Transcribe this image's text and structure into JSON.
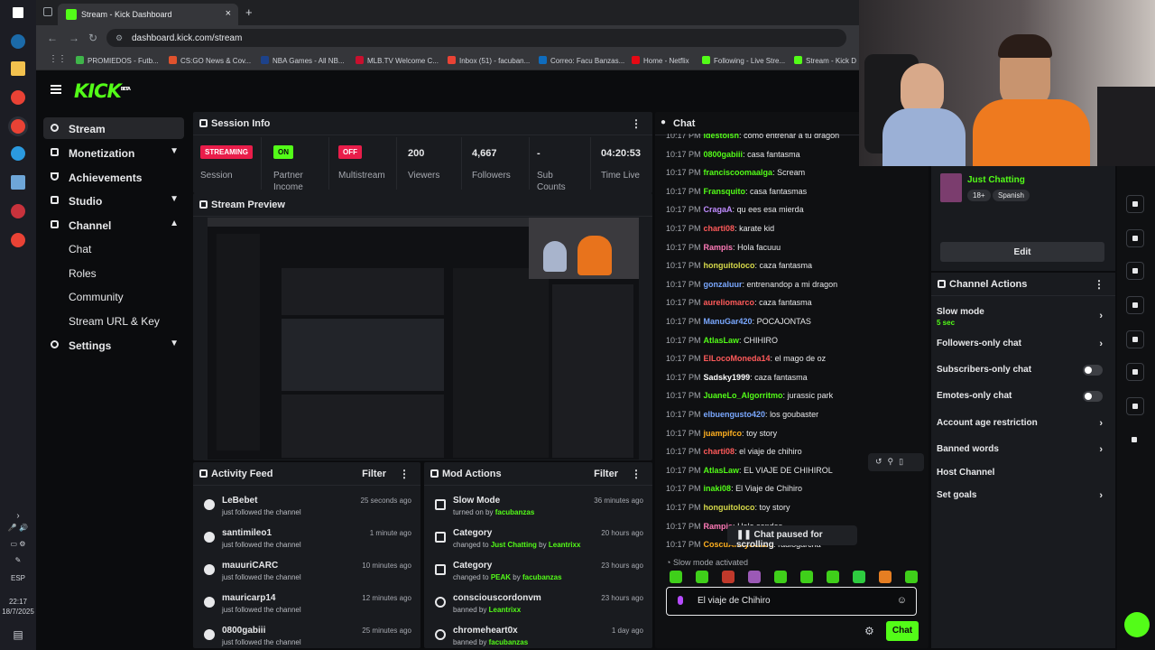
{
  "taskbar": {
    "lang": "ESP",
    "time": "22:17",
    "date": "18/7/2025"
  },
  "browser": {
    "tab_title": "Stream - Kick Dashboard",
    "url": "dashboard.kick.com/stream",
    "bookmarks": [
      "PROMIEDOS - Futb...",
      "CS:GO News & Cov...",
      "NBA Games - All NB...",
      "MLB.TV Welcome C...",
      "Inbox (51) - facuban...",
      "Correo: Facu Banzas...",
      "Home - Netflix",
      "Following - Live Stre...",
      "Stream - Kick D"
    ]
  },
  "logo": {
    "text": "KICK",
    "sup": "BETA"
  },
  "sidebar": {
    "items": [
      {
        "label": "Stream"
      },
      {
        "label": "Monetization"
      },
      {
        "label": "Achievements"
      },
      {
        "label": "Studio"
      },
      {
        "label": "Channel"
      }
    ],
    "channel_sub": [
      "Chat",
      "Roles",
      "Community",
      "Stream URL & Key"
    ],
    "settings": "Settings"
  },
  "session": {
    "title": "Session Info",
    "streaming_badge": "STREAMING",
    "session_label": "Session",
    "partner_badge": "ON",
    "partner_label": "Partner Income",
    "multistream_badge": "OFF",
    "multistream_label": "Multistream",
    "viewers": "200",
    "viewers_label": "Viewers",
    "followers": "4,667",
    "followers_label": "Followers",
    "subs": "-",
    "subs_label": "Sub Counts",
    "time": "04:20:53",
    "time_label": "Time Live"
  },
  "preview": {
    "title": "Stream Preview"
  },
  "activity": {
    "title": "Activity Feed",
    "filter": "Filter",
    "rows": [
      {
        "name": "LeBebet",
        "desc": "just followed the channel",
        "time": "25 seconds ago"
      },
      {
        "name": "santimileo1",
        "desc": "just followed the channel",
        "time": "1 minute ago"
      },
      {
        "name": "mauuriCARC",
        "desc": "just followed the channel",
        "time": "10 minutes ago"
      },
      {
        "name": "mauricarp14",
        "desc": "just followed the channel",
        "time": "12 minutes ago"
      },
      {
        "name": "0800gabiii",
        "desc": "just followed the channel",
        "time": "25 minutes ago"
      }
    ]
  },
  "mod": {
    "title": "Mod Actions",
    "filter": "Filter",
    "rows": [
      {
        "name": "Slow Mode",
        "pre": "turned on by",
        "hl": "facubanzas",
        "mid": "",
        "hl2": "",
        "time": "36 minutes ago"
      },
      {
        "name": "Category",
        "pre": "changed to",
        "hl": "Just Chatting",
        "mid": "by",
        "hl2": "Leantrixx",
        "time": "20 hours ago"
      },
      {
        "name": "Category",
        "pre": "changed to",
        "hl": "PEAK",
        "mid": "by",
        "hl2": "facubanzas",
        "time": "23 hours ago"
      },
      {
        "name": "consciouscordonvm",
        "pre": "banned by",
        "hl": "Leantrixx",
        "mid": "",
        "hl2": "",
        "time": "23 hours ago"
      },
      {
        "name": "chromeheart0x",
        "pre": "banned by",
        "hl": "facubanzas",
        "mid": "",
        "hl2": "",
        "time": "1 day ago"
      }
    ]
  },
  "chat": {
    "title": "Chat",
    "messages": [
      {
        "time": "10:17 PM",
        "user": "idestoish",
        "color": "#53fc18",
        "text": "como entrenar a tu dragon"
      },
      {
        "time": "10:17 PM",
        "user": "0800gabiii",
        "color": "#53fc18",
        "text": "casa fantasma"
      },
      {
        "time": "10:17 PM",
        "user": "franciscoomaalga",
        "color": "#53fc18",
        "text": "Scream"
      },
      {
        "time": "10:17 PM",
        "user": "Fransquito",
        "color": "#53fc18",
        "text": "casa fantasmas"
      },
      {
        "time": "10:17 PM",
        "user": "CragaA",
        "color": "#c08cff",
        "text": "qu ees esa mierda"
      },
      {
        "time": "10:17 PM",
        "user": "charti08",
        "color": "#ff5a5a",
        "text": "karate kid"
      },
      {
        "time": "10:17 PM",
        "user": "Rampis",
        "color": "#ff7ab8",
        "text": "Hola facuuu"
      },
      {
        "time": "10:17 PM",
        "user": "honguitoloco",
        "color": "#d6d94a",
        "text": "caza fantasma"
      },
      {
        "time": "10:17 PM",
        "user": "gonzaluur",
        "color": "#7aa8ff",
        "text": "entrenandop a mi dragon"
      },
      {
        "time": "10:17 PM",
        "user": "aureliomarco",
        "color": "#ff5a5a",
        "text": "caza fantasma"
      },
      {
        "time": "10:17 PM",
        "user": "ManuGar420",
        "color": "#7aa8ff",
        "text": "POCAJONTAS"
      },
      {
        "time": "10:17 PM",
        "user": "AtlasLaw",
        "color": "#53fc18",
        "text": "CHIHIRO"
      },
      {
        "time": "10:17 PM",
        "user": "ElLocoMoneda14",
        "color": "#ff5a5a",
        "text": "el mago de oz"
      },
      {
        "time": "10:17 PM",
        "user": "Sadsky1999",
        "color": "#ffffff",
        "text": "caza fantasma"
      },
      {
        "time": "10:17 PM",
        "user": "JuaneLo_Algorritmo",
        "color": "#53fc18",
        "text": "jurassic park"
      },
      {
        "time": "10:17 PM",
        "user": "elbuengusto420",
        "color": "#7aa8ff",
        "text": "los goubaster"
      },
      {
        "time": "10:17 PM",
        "user": "juampifco",
        "color": "#ffb020",
        "text": "toy story"
      },
      {
        "time": "10:17 PM",
        "user": "charti08",
        "color": "#ff5a5a",
        "text": "el viaje de chihiro"
      },
      {
        "time": "10:17 PM",
        "user": "AtlasLaw",
        "color": "#53fc18",
        "text": "EL VIAJE DE CHIHIROL"
      },
      {
        "time": "10:17 PM",
        "user": "inaki08",
        "color": "#53fc18",
        "text": "El Viaje de Chihiro"
      },
      {
        "time": "10:17 PM",
        "user": "honguitoloco",
        "color": "#d6d94a",
        "text": "toy story"
      },
      {
        "time": "10:17 PM",
        "user": "Rampis",
        "color": "#ff7ab8",
        "text": "Hola sondes"
      },
      {
        "time": "10:17 PM",
        "user": "CoscuArmySeries",
        "color": "#ffb020",
        "text": "radiogarcha"
      }
    ],
    "paused": "Chat paused for scrolling",
    "slow_mode": "Slow mode activated",
    "input_value": "El viaje de Chihiro",
    "send_label": "Chat"
  },
  "stream_info": {
    "category": "Just Chatting",
    "tags": [
      "18+",
      "Spanish"
    ],
    "edit_label": "Edit"
  },
  "channel_actions": {
    "title": "Channel Actions",
    "items": [
      {
        "label": "Slow mode",
        "sub": "5 sec",
        "control": "arrow"
      },
      {
        "label": "Followers-only chat",
        "sub": "",
        "control": "arrow"
      },
      {
        "label": "Subscribers-only chat",
        "sub": "",
        "control": "toggle"
      },
      {
        "label": "Emotes-only chat",
        "sub": "",
        "control": "toggle"
      },
      {
        "label": "Account age restriction",
        "sub": "",
        "control": "arrow"
      },
      {
        "label": "Banned words",
        "sub": "",
        "control": "arrow"
      },
      {
        "label": "Host Channel",
        "sub": "",
        "control": "none"
      },
      {
        "label": "Set goals",
        "sub": "",
        "control": "arrow"
      }
    ]
  },
  "colors": {
    "accent": "#53fc18",
    "live": "#e91d4a",
    "panel": "#191b1f"
  }
}
